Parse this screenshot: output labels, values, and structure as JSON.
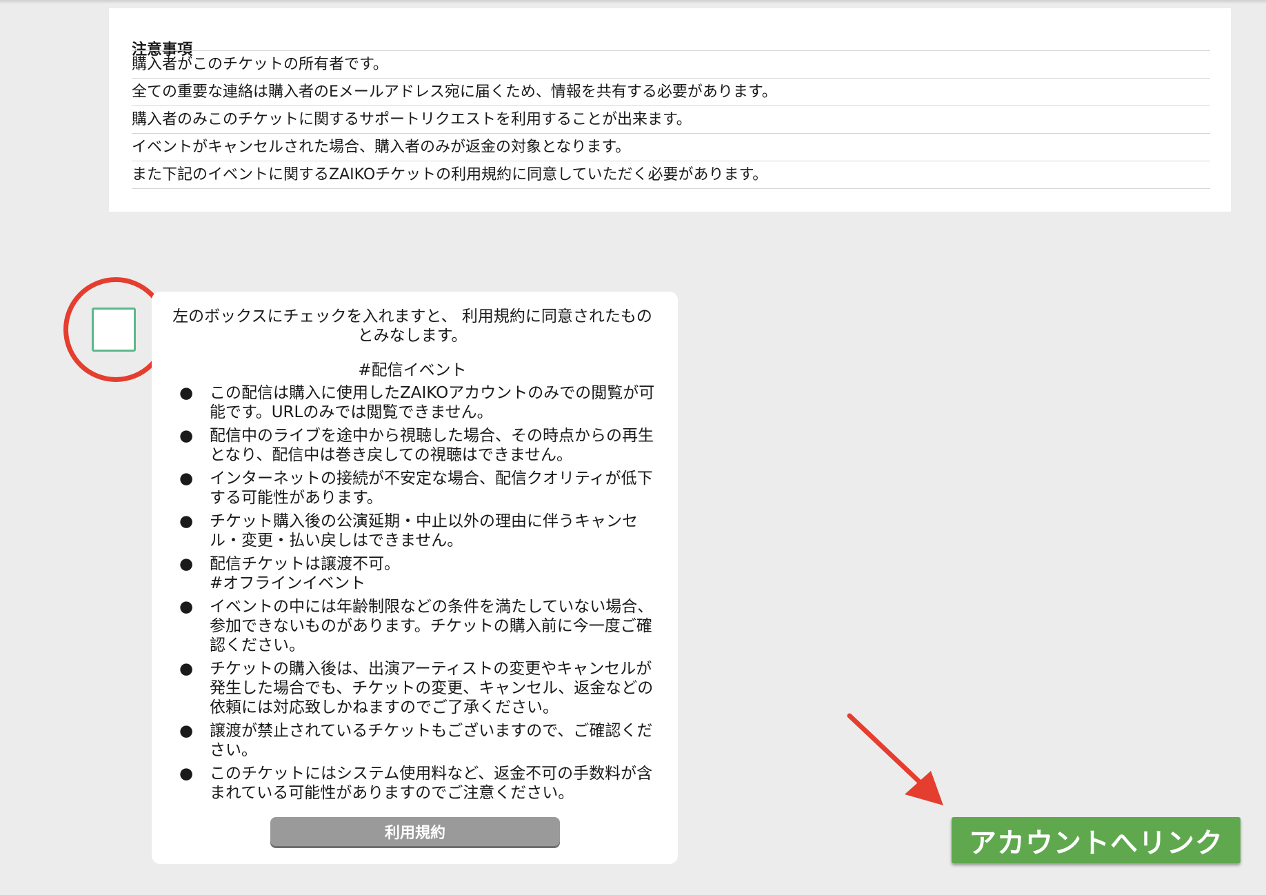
{
  "notice": {
    "title": "注意事項",
    "items": [
      "購入者がこのチケットの所有者です。",
      "全ての重要な連絡は購入者のEメールアドレス宛に届くため、情報を共有する必要があります。",
      "購入者のみこのチケットに関するサポートリクエストを利用することが出来ます。",
      "イベントがキャンセルされた場合、購入者のみが返金の対象となります。",
      "また下記のイベントに関するZAIKOチケットの利用規約に同意していただく必要があります。"
    ]
  },
  "terms": {
    "consent_text": "左のボックスにチェックを入れますと、 利用規約に同意されたものとみなします。",
    "section_online": "#配信イベント",
    "section_offline": "#オフラインイベント",
    "items": [
      "この配信は購入に使用したZAIKOアカウントのみでの閲覧が可能です。URLのみでは閲覧できません。",
      "配信中のライブを途中から視聴した場合、その時点からの再生となり、配信中は巻き戻しての視聴はできません。",
      "インターネットの接続が不安定な場合、配信クオリティが低下する可能性があります。",
      "チケット購入後の公演延期・中止以外の理由に伴うキャンセル・変更・払い戻しはできません。",
      "配信チケットは譲渡不可。",
      "イベントの中には年齢制限などの条件を満たしていない場合、参加できないものがあります。チケットの購入前に今一度ご確認ください。",
      "チケットの購入後は、出演アーティストの変更やキャンセルが発生した場合でも、チケットの変更、キャンセル、返金などの依頼には対応致しかねますのでご了承ください。",
      "譲渡が禁止されているチケットもございますので、ご確認ください。",
      "このチケットにはシステム使用料など、返金不可の手数料が含まれている可能性がありますのでご注意ください。"
    ],
    "bullet": "●",
    "button_label": "利用規約"
  },
  "checkbox": {
    "checked": false
  },
  "link_account_button": {
    "label": "アカウントへリンク"
  },
  "colors": {
    "page_bg": "#ececec",
    "checkbox_border": "#5cb88a",
    "annotation_red": "#e53d2e",
    "link_button": "#5fa84e",
    "terms_button": "#9a9a9a"
  },
  "icons": [
    "checkbox-icon",
    "arrow-annotation-icon",
    "circle-highlight"
  ]
}
